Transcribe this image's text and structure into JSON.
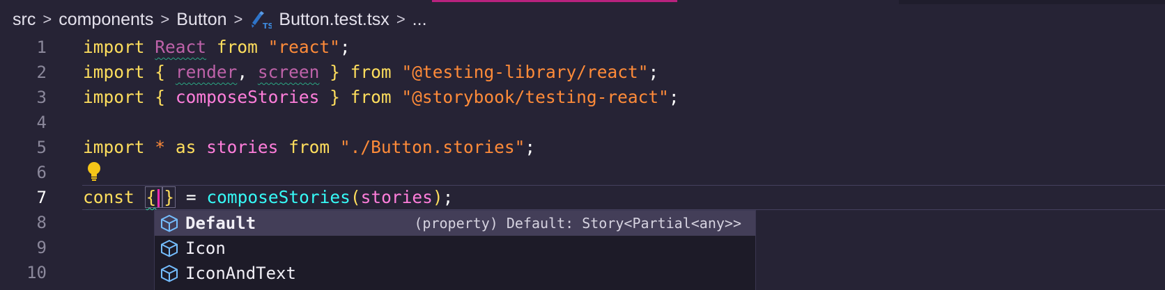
{
  "breadcrumb": {
    "items": [
      "src",
      "components",
      "Button",
      "Button.test.tsx",
      "..."
    ],
    "separator": ">",
    "file_icon": "typescript-test-icon"
  },
  "editor": {
    "active_line": 7,
    "line_numbers": [
      "1",
      "2",
      "3",
      "4",
      "5",
      "6",
      "7",
      "8",
      "9",
      "10"
    ],
    "lines": {
      "l1": {
        "import": "import",
        "react": "React",
        "from": "from",
        "str": "\"react\"",
        "semi": ";"
      },
      "l2": {
        "import": "import",
        "open": "{",
        "render": "render",
        "comma": ",",
        "screen": "screen",
        "close": "}",
        "from": "from",
        "str": "\"@testing-library/react\"",
        "semi": ";"
      },
      "l3": {
        "import": "import",
        "open": "{",
        "compose": "composeStories",
        "close": "}",
        "from": "from",
        "str": "\"@storybook/testing-react\"",
        "semi": ";"
      },
      "l5": {
        "import": "import",
        "star": "*",
        "as": "as",
        "stories": "stories",
        "from": "from",
        "str": "\"./Button.stories\"",
        "semi": ";"
      },
      "l7": {
        "const": "const",
        "open": "{",
        "close": "}",
        "eq": "=",
        "fn": "composeStories",
        "paren_open": "(",
        "arg": "stories",
        "paren_close": ")",
        "semi": ";"
      }
    },
    "lightbulb_icon": "lightbulb-icon"
  },
  "suggestions": {
    "items": [
      {
        "label": "Default",
        "detail": "(property) Default: Story<Partial<any>>",
        "icon": "property-cube-icon",
        "selected": true
      },
      {
        "label": "Icon",
        "detail": "",
        "icon": "property-cube-icon",
        "selected": false
      },
      {
        "label": "IconAndText",
        "detail": "",
        "icon": "property-cube-icon",
        "selected": false
      }
    ]
  },
  "colors": {
    "background": "#262335",
    "keyword": "#fede5d",
    "identifier": "#ff7edb",
    "string": "#ff8b39",
    "function": "#36f9f6",
    "cursor": "#f92aad",
    "suggest_bg": "#1d1b28",
    "suggest_selected": "#433e58",
    "cube_icon": "#75beff"
  }
}
